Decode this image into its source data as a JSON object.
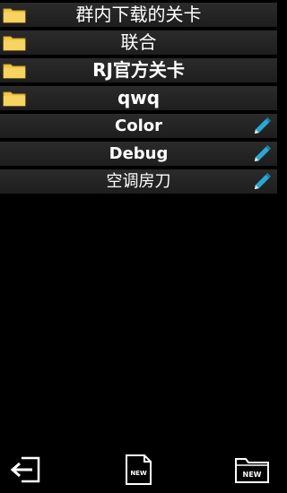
{
  "folders": [
    {
      "label": "群内下载的关卡",
      "icon": "folder-icon"
    },
    {
      "label": "联合",
      "icon": "folder-icon"
    },
    {
      "label": "RJ官方关卡",
      "icon": "folder-icon"
    },
    {
      "label": "qwq",
      "icon": "folder-icon"
    }
  ],
  "levels": [
    {
      "label": "Color",
      "icon": "edit-pencil-icon"
    },
    {
      "label": "Debug",
      "icon": "edit-pencil-icon"
    },
    {
      "label": "空调房刀",
      "icon": "edit-pencil-icon"
    }
  ],
  "toolbar": {
    "back_icon": "exit-back-icon",
    "new_level_label": "NEW",
    "new_folder_label": "NEW"
  },
  "colors": {
    "background": "#000000",
    "row": "#262626",
    "folder": "#f2c94c",
    "pencil": "#29a8d6"
  }
}
